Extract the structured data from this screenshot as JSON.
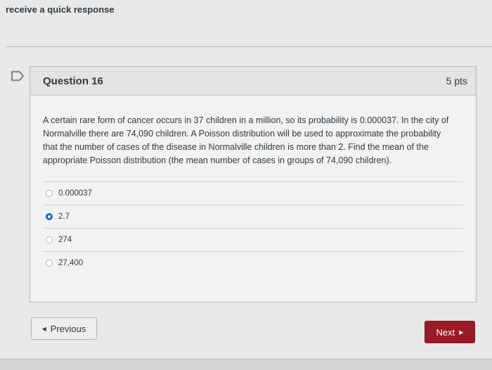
{
  "page": {
    "header_text": "receive a quick response"
  },
  "question": {
    "title": "Question 16",
    "points": "5 pts",
    "text": "A certain rare form of cancer occurs in 37 children in a million, so its probability is 0.000037. In the city of Normalville there are 74,090 children. A Poisson distribution will be used to approximate the probability that the number of cases of the disease in Normalville children is more than 2. Find the mean of the appropriate Poisson distribution (the mean number of cases in groups of 74,090 children).",
    "answers": [
      {
        "label": "0.000037",
        "selected": false
      },
      {
        "label": "2.7",
        "selected": true
      },
      {
        "label": "274",
        "selected": false
      },
      {
        "label": "27,400",
        "selected": false
      }
    ]
  },
  "nav": {
    "previous_label": "Previous",
    "next_label": "Next"
  },
  "colors": {
    "next_button": "#9a1b23",
    "selected_radio": "#1a63c7"
  }
}
